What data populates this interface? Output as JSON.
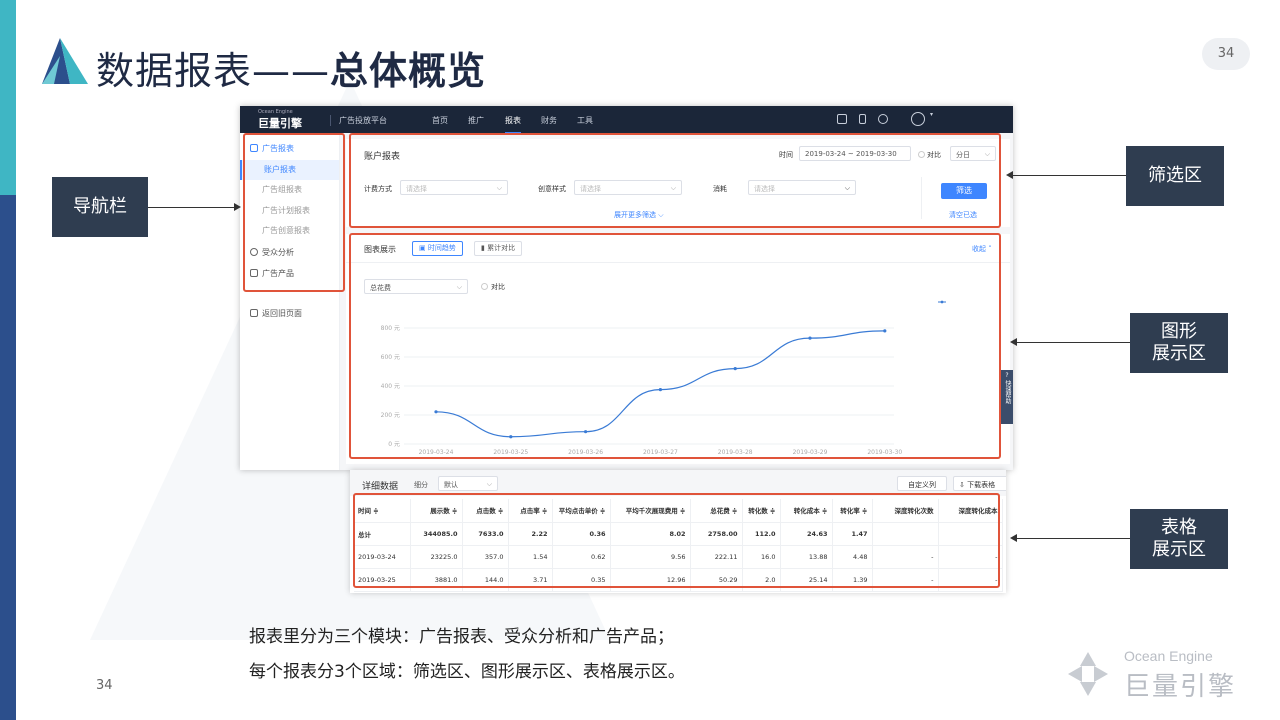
{
  "slide": {
    "title_light": "数据报表——",
    "title_bold": "总体概览",
    "page_badge": "34",
    "page_number": "34",
    "description_line1": "报表里分为三个模块：广告报表、受众分析和广告产品；",
    "description_line2": "每个报表分3个区域：筛选区、图形展示区、表格展示区。",
    "footer_logo_en": "Ocean Engine",
    "footer_logo_cn": "巨量引擎",
    "callouts": {
      "nav": "导航栏",
      "filter": "筛选区",
      "chart_line1": "图形",
      "chart_line2": "展示区",
      "table_line1": "表格",
      "table_line2": "展示区"
    },
    "colors": {
      "accent_blue": "#2c4f8c",
      "accent_teal": "#3fb6c4",
      "highlight_red": "#e0543a",
      "callout_bg": "#2f3d50"
    }
  },
  "app": {
    "brand": "巨量引擎",
    "brand_sub": "Ocean Engine",
    "platform": "广告投放平台",
    "nav": [
      "首页",
      "推广",
      "报表",
      "财务",
      "工具"
    ],
    "active_nav": "报表",
    "sidebar": {
      "group_report": "广告报表",
      "report_items": [
        "账户报表",
        "广告组报表",
        "广告计划报表",
        "广告创意报表"
      ],
      "group_audience": "受众分析",
      "group_product": "广告产品",
      "back": "返回旧页面"
    },
    "filter": {
      "title": "账户报表",
      "time_label": "时间",
      "date_range": "2019-03-24 ~ 2019-03-30",
      "compare": "对比",
      "granularity": "分日",
      "billing_label": "计费方式",
      "creative_label": "创意样式",
      "consume_label": "消耗",
      "placeholder": "请选择",
      "filter_button": "筛选",
      "expand": "展开更多筛选",
      "clear": "清空已选"
    },
    "chart_panel": {
      "title": "图表展示",
      "tab_trend": "时间趋势",
      "tab_cumulative": "累计对比",
      "collapse": "收起",
      "metric": "总花费",
      "compare": "对比"
    },
    "help_tab": "快速帮助",
    "table": {
      "title": "详细数据",
      "granularity_label": "细分",
      "granularity_value": "默认",
      "customize": "自定义列",
      "download": "下载表格",
      "columns": [
        "时间 ≑",
        "展示数 ≑",
        "点击数 ≑",
        "点击率 ≑",
        "平均点击单价 ≑",
        "平均千次展现费用 ≑",
        "总花费 ≑",
        "转化数 ≑",
        "转化成本 ≑",
        "转化率 ≑",
        "深度转化次数",
        "深度转化成本"
      ],
      "rows": [
        [
          "总计",
          "344085.0",
          "7633.0",
          "2.22",
          "0.36",
          "8.02",
          "2758.00",
          "112.0",
          "24.63",
          "1.47",
          "",
          ""
        ],
        [
          "2019-03-24",
          "23225.0",
          "357.0",
          "1.54",
          "0.62",
          "9.56",
          "222.11",
          "16.0",
          "13.88",
          "4.48",
          "-",
          "-"
        ],
        [
          "2019-03-25",
          "3881.0",
          "144.0",
          "3.71",
          "0.35",
          "12.96",
          "50.29",
          "2.0",
          "25.14",
          "1.39",
          "-",
          "-"
        ]
      ]
    }
  },
  "chart_data": {
    "type": "line",
    "x": [
      "2019-03-24",
      "2019-03-25",
      "2019-03-26",
      "2019-03-27",
      "2019-03-28",
      "2019-03-29",
      "2019-03-30"
    ],
    "series": [
      {
        "values": [
          222,
          50,
          85,
          375,
          520,
          730,
          780
        ]
      }
    ],
    "ylim": [
      0,
      800
    ],
    "yticks": [
      "0 元",
      "200 元",
      "400 元",
      "600 元",
      "800 元"
    ],
    "grid": true,
    "legend": "top-right",
    "color": "#3a7bd5"
  }
}
